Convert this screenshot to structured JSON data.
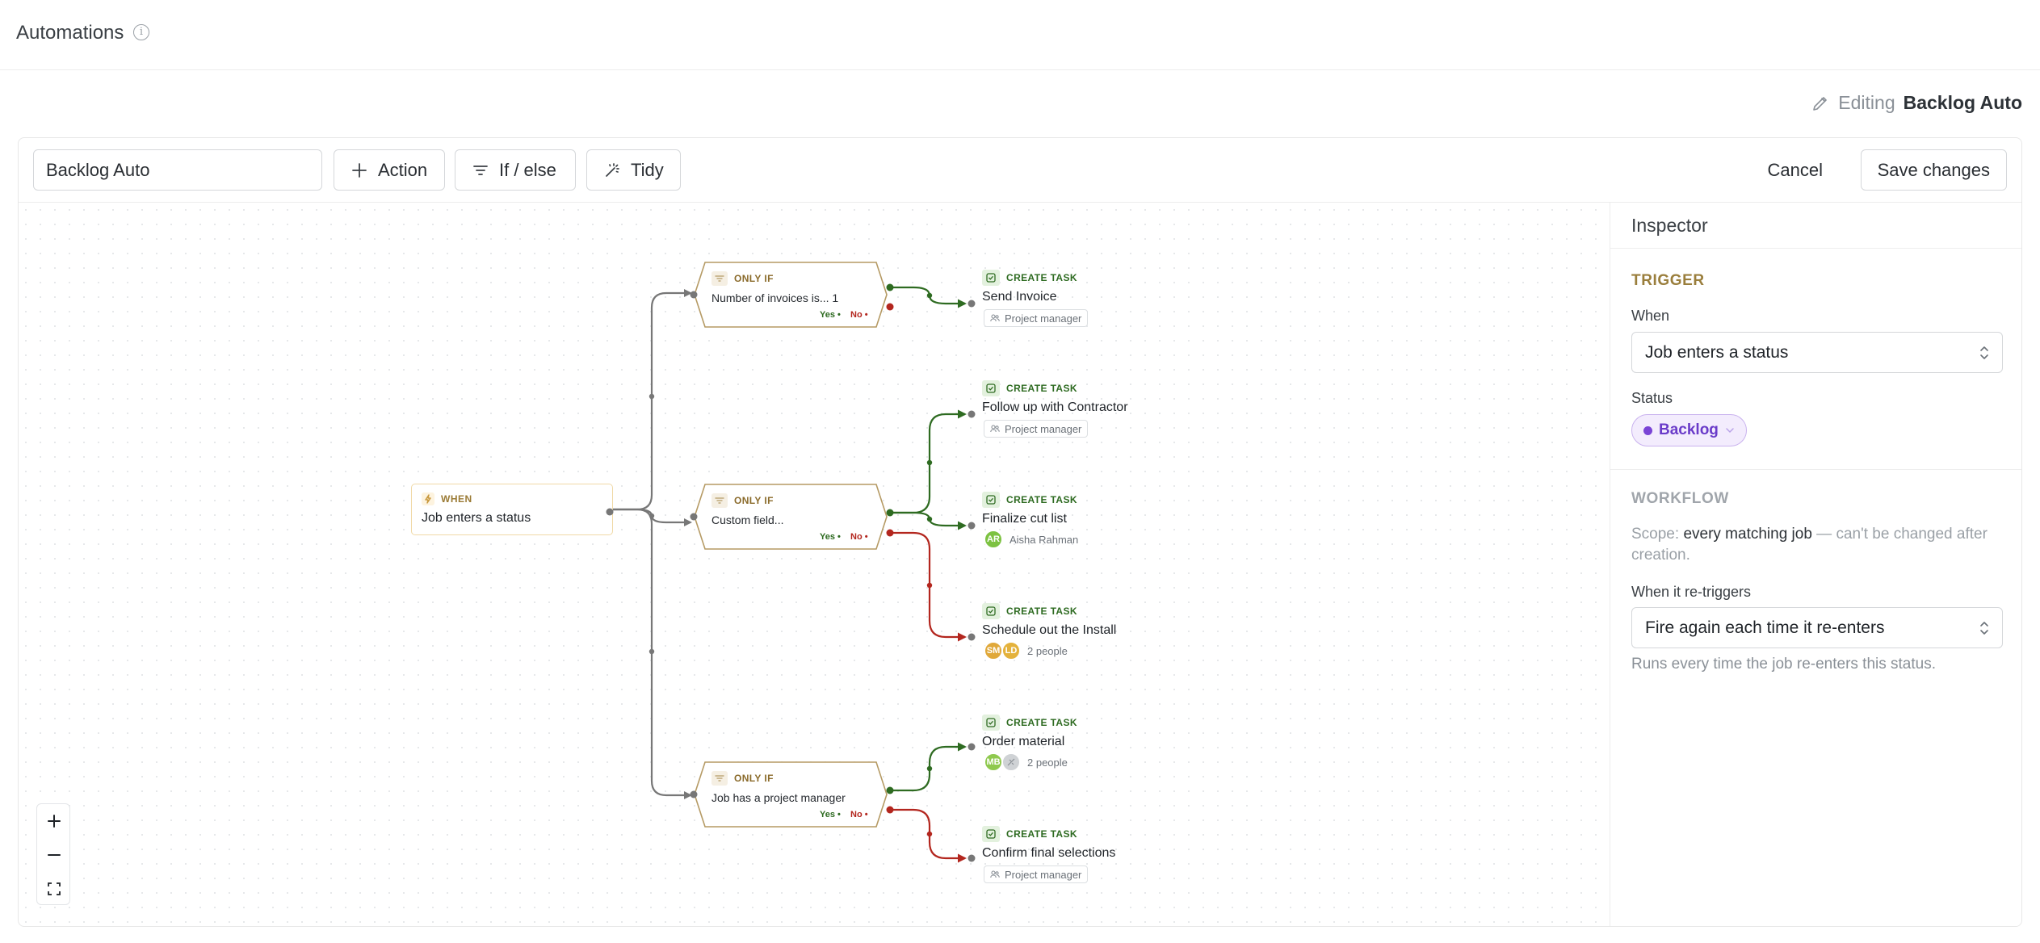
{
  "header": {
    "title": "Automations",
    "info_icon": "info-icon"
  },
  "editing": {
    "label": "Editing",
    "name": "Backlog Auto"
  },
  "toolbar": {
    "name_value": "Backlog Auto",
    "action_label": "Action",
    "ifelse_label": "If / else",
    "tidy_label": "Tidy",
    "cancel_label": "Cancel",
    "save_label": "Save changes"
  },
  "flow": {
    "trigger": {
      "label": "WHEN",
      "title": "Job enters a status"
    },
    "conditions": [
      {
        "label": "ONLY IF",
        "title": "Number of invoices is... 1",
        "yes": "Yes",
        "no": "No"
      },
      {
        "label": "ONLY IF",
        "title": "Custom field...",
        "yes": "Yes",
        "no": "No"
      },
      {
        "label": "ONLY IF",
        "title": "Job has a project manager",
        "yes": "Yes",
        "no": "No"
      }
    ],
    "tasks": [
      {
        "label": "CREATE TASK",
        "title": "Send Invoice",
        "role": "Project manager"
      },
      {
        "label": "CREATE TASK",
        "title": "Follow up with Contractor",
        "role": "Project manager"
      },
      {
        "label": "CREATE TASK",
        "title": "Finalize cut list",
        "avatars": [
          "AR"
        ],
        "assignee": "Aisha Rahman"
      },
      {
        "label": "CREATE TASK",
        "title": "Schedule out the Install",
        "avatars": [
          "SM",
          "LD"
        ],
        "assignee": "2 people"
      },
      {
        "label": "CREATE TASK",
        "title": "Order material",
        "avatars": [
          "MB",
          ""
        ],
        "assignee": "2 people"
      },
      {
        "label": "CREATE TASK",
        "title": "Confirm final selections",
        "role": "Project manager"
      }
    ]
  },
  "zoom": {
    "in_icon": "plus-icon",
    "out_icon": "minus-icon",
    "fit_icon": "fit-view-icon"
  },
  "inspector": {
    "title": "Inspector",
    "trigger_section": "TRIGGER",
    "when_label": "When",
    "when_value": "Job enters a status",
    "status_label": "Status",
    "status_value": "Backlog",
    "workflow_section": "WORKFLOW",
    "scope_prefix": "Scope: ",
    "scope_value": "every matching job",
    "scope_suffix": " — can't be changed after creation.",
    "retrigger_label": "When it re-triggers",
    "retrigger_value": "Fire again each time it re-enters",
    "retrigger_help": "Runs every time the job re-enters this status."
  },
  "colors": {
    "yes_branch": "#2e6b21",
    "no_branch": "#b3261e",
    "trunk": "#777777",
    "condition_border": "#b59a64",
    "trigger_border": "#f0d9a6",
    "status_purple": "#7a44d6",
    "avatar_AR": "#7dc242",
    "avatar_SM": "#e0a83a",
    "avatar_LD": "#e4b23c",
    "avatar_MB": "#8fc94e",
    "avatar_none": "#cfd2d5"
  }
}
